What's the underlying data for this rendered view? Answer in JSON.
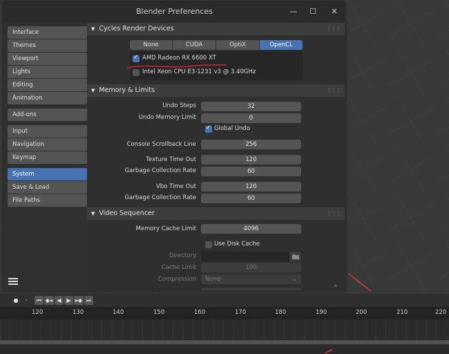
{
  "window": {
    "title": "Blender Preferences",
    "minimize": "—",
    "maximize": "☐",
    "close": "✕"
  },
  "sidebar": {
    "items": [
      {
        "label": "Interface"
      },
      {
        "label": "Themes"
      },
      {
        "label": "Viewport"
      },
      {
        "label": "Lights"
      },
      {
        "label": "Editing"
      },
      {
        "label": "Animation"
      },
      {
        "label": "Add-ons"
      },
      {
        "label": "Input"
      },
      {
        "label": "Navigation"
      },
      {
        "label": "Keymap"
      },
      {
        "label": "System"
      },
      {
        "label": "Save & Load"
      },
      {
        "label": "File Paths"
      }
    ],
    "active": "System"
  },
  "cycles": {
    "header": "Cycles Render Devices",
    "tabs": [
      "None",
      "CUDA",
      "OptiX",
      "OpenCL"
    ],
    "active_tab": "OpenCL",
    "devices": [
      {
        "label": "AMD Radeon RX 6600 XT",
        "checked": true
      },
      {
        "label": "Intel Xeon CPU E3-1231 v3 @ 3.40GHz",
        "checked": false
      }
    ]
  },
  "memory": {
    "header": "Memory & Limits",
    "undo_steps_label": "Undo Steps",
    "undo_steps": "32",
    "undo_memory_label": "Undo Memory Limit",
    "undo_memory": "0",
    "global_undo_label": "Global Undo",
    "global_undo": true,
    "console_label": "Console Scrollback Line",
    "console": "256",
    "texture_timeout_label": "Texture Time Out",
    "texture_timeout": "120",
    "gc_rate_label": "Garbage Collection Rate",
    "gc_rate": "60",
    "vbo_timeout_label": "Vbo Time Out",
    "vbo_timeout": "120",
    "vbo_gc_rate_label": "Garbage Collection Rate",
    "vbo_gc_rate": "60"
  },
  "sequencer": {
    "header": "Video Sequencer",
    "cache_limit_label": "Memory Cache Limit",
    "cache_limit": "4096",
    "disk_cache_label": "Use Disk Cache",
    "directory_label": "Directory",
    "directory": "",
    "disk_cache_limit_label": "Cache Limit",
    "disk_cache_limit": "100",
    "compression_label": "Compression",
    "compression": "None"
  },
  "timeline": {
    "ticks": [
      "120",
      "130",
      "140",
      "150",
      "160",
      "170",
      "180",
      "190",
      "200",
      "210",
      "220"
    ]
  },
  "colors": {
    "accent": "#4772b3",
    "annotation": "#d6203a"
  }
}
